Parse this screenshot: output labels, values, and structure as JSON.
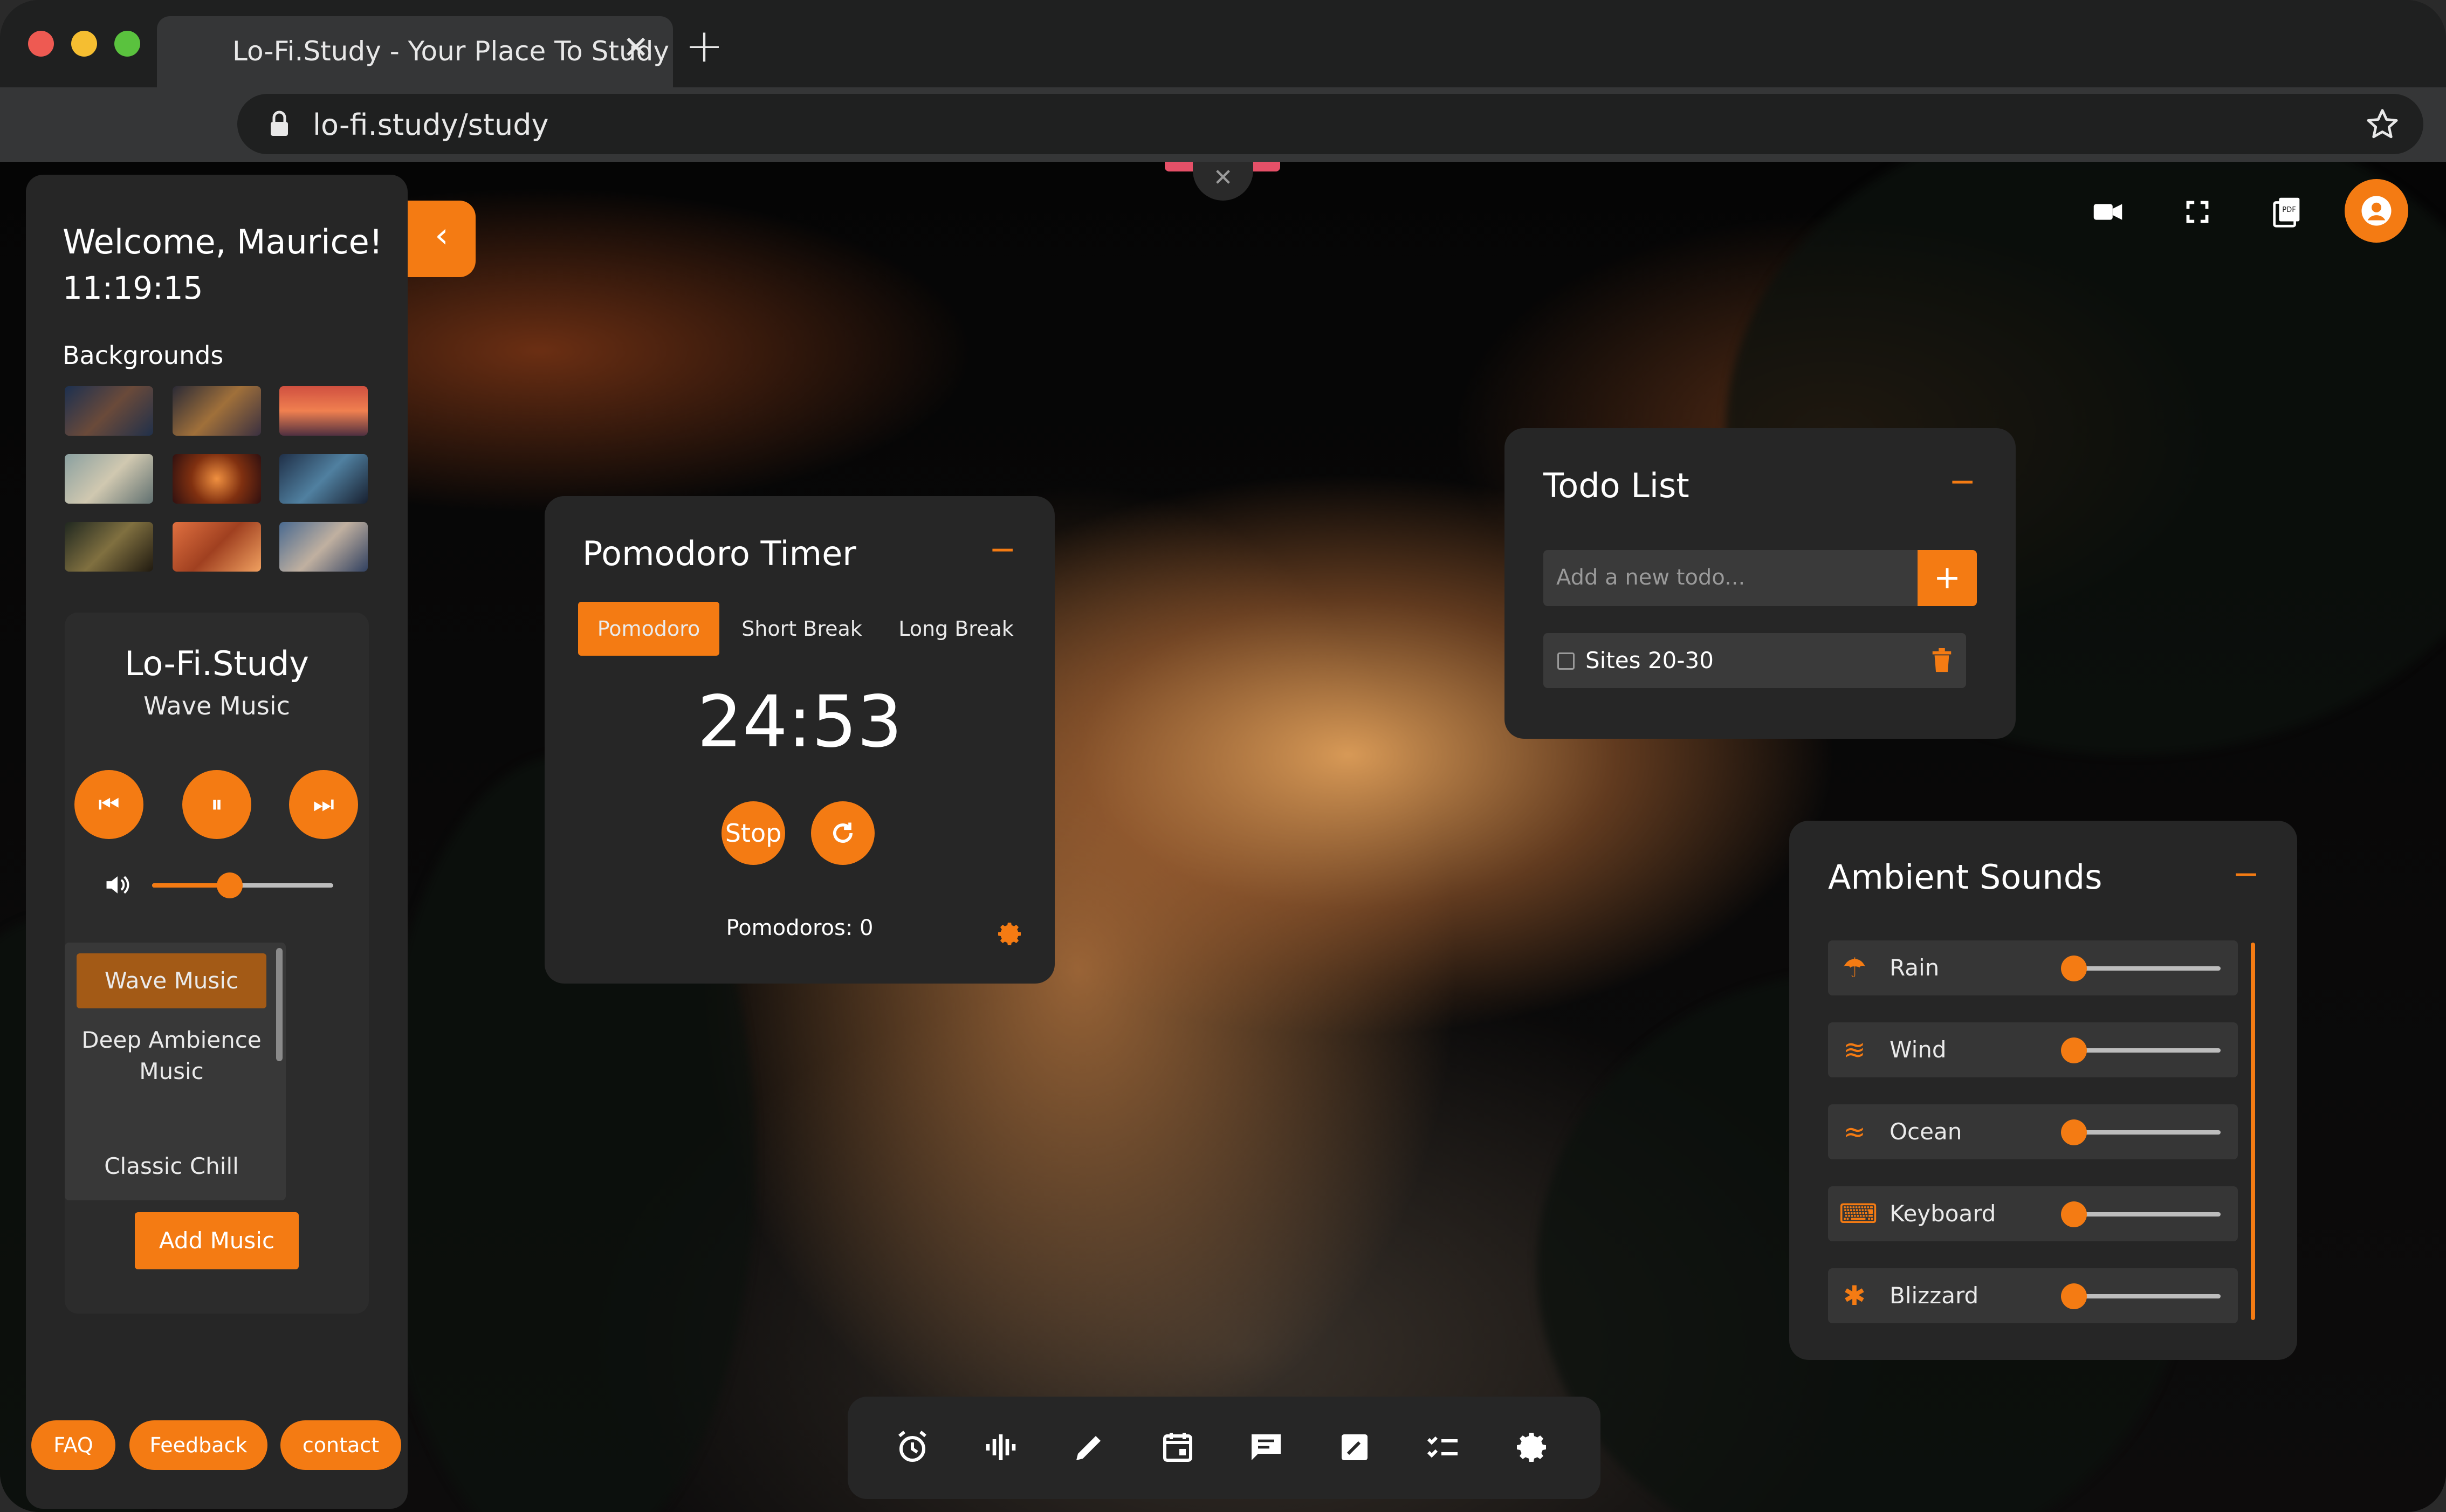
{
  "browser": {
    "tab_title": "Lo-Fi.Study - Your Place To Study",
    "url": "lo-fi.study/study",
    "close_tab": "✕",
    "new_tab": "+"
  },
  "sidebar": {
    "welcome": "Welcome, Maurice!",
    "clock": "11:19:15",
    "backgrounds_heading": "Backgrounds",
    "collapse_icon": "‹",
    "music": {
      "title": "Lo-Fi.Study",
      "subtitle": "Wave Music",
      "volume_level": 0.43,
      "playlist": [
        "Wave Music",
        "Deep Ambience Music",
        "Classic Chill"
      ],
      "selected": "Wave Music",
      "add_label": "Add Music"
    },
    "footer": {
      "faq": "FAQ",
      "feedback": "Feedback",
      "contact": "contact"
    }
  },
  "pomodoro": {
    "title": "Pomodoro Timer",
    "minimize": "−",
    "tabs": [
      "Pomodoro",
      "Short Break",
      "Long Break"
    ],
    "active_tab": "Pomodoro",
    "time": "24:53",
    "stop_label": "Stop",
    "pomodoros_label": "Pomodoros: 0"
  },
  "todo": {
    "title": "Todo List",
    "minimize": "−",
    "placeholder": "Add a new todo...",
    "add_icon": "+",
    "items": [
      {
        "text": "Sites 20-30",
        "done": false
      }
    ]
  },
  "ambient": {
    "title": "Ambient Sounds",
    "minimize": "−",
    "sounds": [
      {
        "label": "Rain",
        "icon": "umbrella-icon",
        "level": 0
      },
      {
        "label": "Wind",
        "icon": "wind-icon",
        "level": 0
      },
      {
        "label": "Ocean",
        "icon": "waves-icon",
        "level": 0
      },
      {
        "label": "Keyboard",
        "icon": "keyboard-icon",
        "level": 0
      },
      {
        "label": "Blizzard",
        "icon": "snowflake-icon",
        "level": 0
      }
    ]
  },
  "colors": {
    "accent": "#f47b13",
    "panel": "#262626",
    "text": "#eaeaea"
  }
}
